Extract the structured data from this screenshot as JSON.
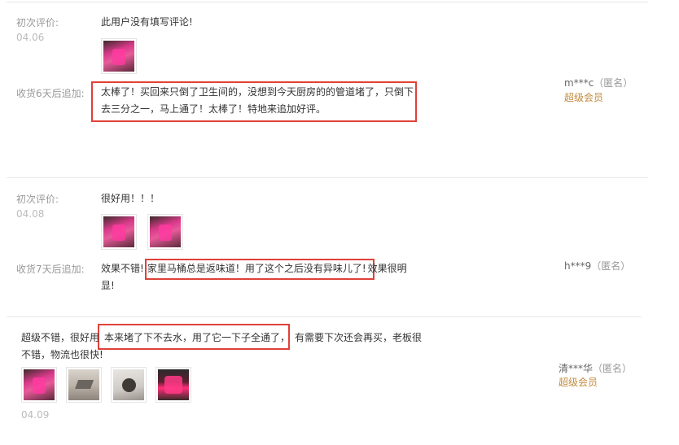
{
  "reviews": [
    {
      "initial_label": "初次评价:",
      "initial_date": "04.06",
      "initial_text": "此用户没有填写评论!",
      "followup_label": "收货6天后追加:",
      "followup_text_1": "太棒了！买回来只倒了卫生间的，没想到今天厨房的的管道堵了，只倒下",
      "followup_text_2": "去三分之一，马上通了！太棒了！特地来追加好评。",
      "user": "m***c",
      "anon": "（匿名）",
      "member": "超级会员"
    },
    {
      "initial_label": "初次评价:",
      "initial_date": "04.08",
      "initial_text": "很好用！！！",
      "followup_label": "收货7天后追加:",
      "followup_pre": "效果不错!",
      "followup_highlight": "家里马桶总是返味道！用了这个之后没有异味儿了!",
      "followup_post": "效果很明",
      "followup_line2": "显!",
      "user": "h***9",
      "anon": "（匿名）"
    },
    {
      "text_pre": "超级不错，很好用",
      "text_highlight": "本来堵了下不去水，用了它一下子全通了，",
      "text_post": "有需要下次还会再买，老板很",
      "text_line2": "不错，物流也很快!",
      "date": "04.09",
      "user": "清***华",
      "anon": "（匿名）",
      "member": "超级会员"
    }
  ]
}
